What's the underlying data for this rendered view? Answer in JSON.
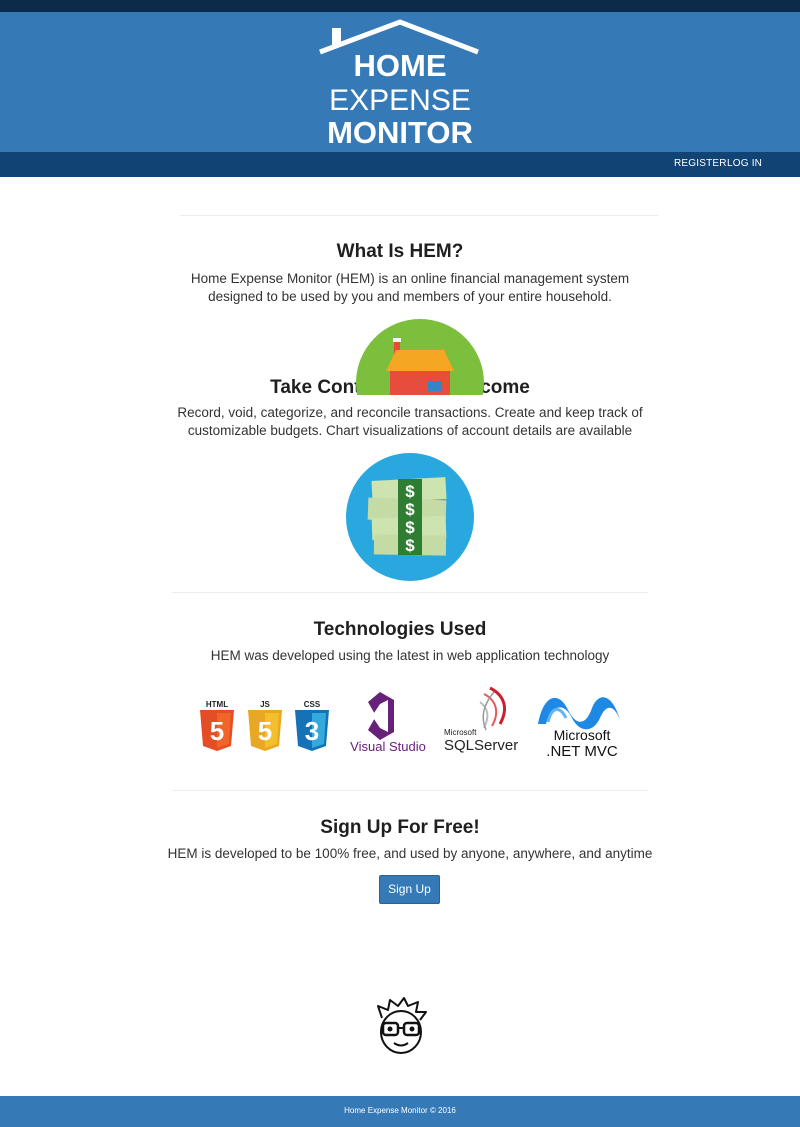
{
  "brand": {
    "logo_line1": "HOME",
    "logo_line2": "EXPENSE",
    "logo_line3": "MONITOR",
    "primary_color": "#357ab7",
    "dark_color": "#114374"
  },
  "nav": {
    "register": "REGISTER",
    "login": "LOG IN"
  },
  "what_is": {
    "title": "What Is HEM?",
    "text": "Home Expense Monitor (HEM) is an online financial management system designed to be used by you and members of your entire household."
  },
  "income": {
    "title": "Take Control Of Your Income",
    "text": "Record, void, categorize, and reconcile transactions. Create and keep track of customizable budgets. Chart visualizations of account details are available",
    "house_icon": "house-icon",
    "money_icon": "money-icon",
    "money_symbols": [
      "$",
      "$",
      "$",
      "$"
    ]
  },
  "technologies": {
    "title": "Technologies Used",
    "text": "HEM was developed using the latest in web application technology",
    "html_label": "HTML",
    "html_num": "5",
    "js_label": "JS",
    "js_num": "5",
    "css_label": "CSS",
    "css_num": "3",
    "vs_label": "Visual Studio",
    "sql_top": "Microsoft",
    "sql_bottom": "SQLServer",
    "mvc_top": "Microsoft",
    "mvc_bottom": ".NET MVC"
  },
  "signup": {
    "title": "Sign Up For Free!",
    "text": "HEM is developed to be 100% free, and used by anyone, anywhere, and anytime",
    "button": "Sign Up"
  },
  "footer": {
    "text": "Home Expense Monitor © 2016"
  }
}
